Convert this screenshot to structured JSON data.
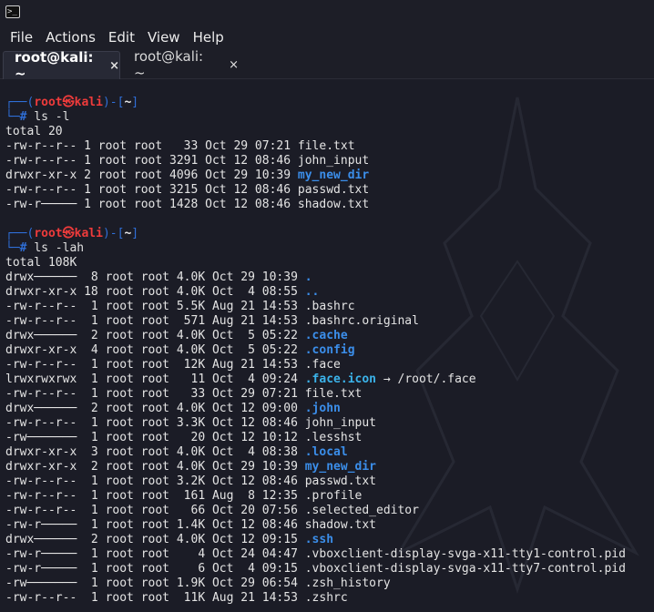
{
  "window": {
    "icon": "terminal-icon"
  },
  "menu": [
    "File",
    "Actions",
    "Edit",
    "View",
    "Help"
  ],
  "tabs": [
    {
      "label": "root@kali: ~",
      "close": "×",
      "active": true
    },
    {
      "label": "root@kali: ~",
      "close": "×",
      "active": false
    }
  ],
  "colors": {
    "background": "#1b1c26",
    "prompt_frame": "#2f6fd8",
    "prompt_user": "#ee3b3b",
    "directory": "#3b8eea"
  },
  "prompt": {
    "top_prefix": "┌──(",
    "user": "root",
    "at": "㉿",
    "host": "kali",
    "mid": ")-[",
    "path": "~",
    "end": "]",
    "bottom_prefix": "└─",
    "hash": "#"
  },
  "sessions": [
    {
      "command": "ls -l",
      "total": "total 20",
      "rows": [
        {
          "meta": "-rw-r--r-- 1 root root   33 Oct 29 07:21 ",
          "name": "file.txt",
          "type": "file"
        },
        {
          "meta": "-rw-r--r-- 1 root root 3291 Oct 12 08:46 ",
          "name": "john_input",
          "type": "file"
        },
        {
          "meta": "drwxr-xr-x 2 root root 4096 Oct 29 10:39 ",
          "name": "my_new_dir",
          "type": "dir"
        },
        {
          "meta": "-rw-r--r-- 1 root root 3215 Oct 12 08:46 ",
          "name": "passwd.txt",
          "type": "file"
        },
        {
          "meta": "-rw-r───── 1 root root 1428 Oct 12 08:46 ",
          "name": "shadow.txt",
          "type": "file"
        }
      ]
    },
    {
      "command": "ls -lah",
      "total": "total 108K",
      "rows": [
        {
          "meta": "drwx──────  8 root root 4.0K Oct 29 10:39 ",
          "name": ".",
          "type": "dir"
        },
        {
          "meta": "drwxr-xr-x 18 root root 4.0K Oct  4 08:55 ",
          "name": "..",
          "type": "dir"
        },
        {
          "meta": "-rw-r--r--  1 root root 5.5K Aug 21 14:53 ",
          "name": ".bashrc",
          "type": "file"
        },
        {
          "meta": "-rw-r--r--  1 root root  571 Aug 21 14:53 ",
          "name": ".bashrc.original",
          "type": "file"
        },
        {
          "meta": "drwx──────  2 root root 4.0K Oct  5 05:22 ",
          "name": ".cache",
          "type": "dir"
        },
        {
          "meta": "drwxr-xr-x  4 root root 4.0K Oct  5 05:22 ",
          "name": ".config",
          "type": "dir"
        },
        {
          "meta": "-rw-r--r--  1 root root  12K Aug 21 14:53 ",
          "name": ".face",
          "type": "file"
        },
        {
          "meta": "lrwxrwxrwx  1 root root   11 Oct  4 09:24 ",
          "name": ".face.icon",
          "type": "link",
          "target": " → /root/.face"
        },
        {
          "meta": "-rw-r--r--  1 root root   33 Oct 29 07:21 ",
          "name": "file.txt",
          "type": "file"
        },
        {
          "meta": "drwx──────  2 root root 4.0K Oct 12 09:00 ",
          "name": ".john",
          "type": "dir"
        },
        {
          "meta": "-rw-r--r--  1 root root 3.3K Oct 12 08:46 ",
          "name": "john_input",
          "type": "file"
        },
        {
          "meta": "-rw───────  1 root root   20 Oct 12 10:12 ",
          "name": ".lesshst",
          "type": "file"
        },
        {
          "meta": "drwxr-xr-x  3 root root 4.0K Oct  4 08:38 ",
          "name": ".local",
          "type": "dir"
        },
        {
          "meta": "drwxr-xr-x  2 root root 4.0K Oct 29 10:39 ",
          "name": "my_new_dir",
          "type": "dir"
        },
        {
          "meta": "-rw-r--r--  1 root root 3.2K Oct 12 08:46 ",
          "name": "passwd.txt",
          "type": "file"
        },
        {
          "meta": "-rw-r--r--  1 root root  161 Aug  8 12:35 ",
          "name": ".profile",
          "type": "file"
        },
        {
          "meta": "-rw-r--r--  1 root root   66 Oct 20 07:56 ",
          "name": ".selected_editor",
          "type": "file"
        },
        {
          "meta": "-rw-r─────  1 root root 1.4K Oct 12 08:46 ",
          "name": "shadow.txt",
          "type": "file"
        },
        {
          "meta": "drwx──────  2 root root 4.0K Oct 12 09:15 ",
          "name": ".ssh",
          "type": "dir"
        },
        {
          "meta": "-rw-r─────  1 root root    4 Oct 24 04:47 ",
          "name": ".vboxclient-display-svga-x11-tty1-control.pid",
          "type": "file"
        },
        {
          "meta": "-rw-r─────  1 root root    6 Oct  4 09:15 ",
          "name": ".vboxclient-display-svga-x11-tty7-control.pid",
          "type": "file"
        },
        {
          "meta": "-rw───────  1 root root 1.9K Oct 29 06:54 ",
          "name": ".zsh_history",
          "type": "file"
        },
        {
          "meta": "-rw-r--r--  1 root root  11K Aug 21 14:53 ",
          "name": ".zshrc",
          "type": "file"
        }
      ]
    }
  ]
}
